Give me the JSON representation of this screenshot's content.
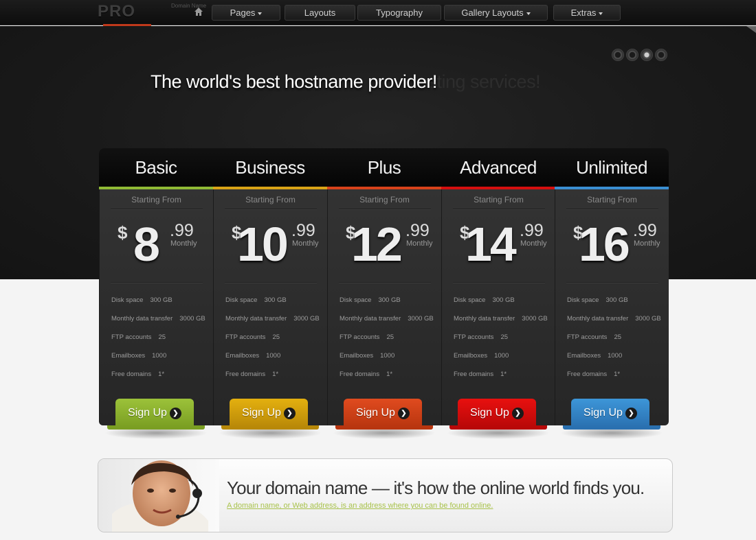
{
  "brand": {
    "logo": "PRO",
    "domain_tag": "Domain Name"
  },
  "nav": [
    {
      "label": "Pages",
      "dropdown": true
    },
    {
      "label": "Layouts",
      "dropdown": false
    },
    {
      "label": "Typography",
      "dropdown": false
    },
    {
      "label": "Gallery Layouts",
      "dropdown": true
    },
    {
      "label": "Extras",
      "dropdown": true
    }
  ],
  "hero": {
    "title": "The world's best hostname provider!",
    "ghost_text": "osting services!",
    "slides": 4,
    "active_slide": 3
  },
  "pricing": {
    "starting_label": "Starting From",
    "currency": "$",
    "period": "Monthly",
    "signup_label": "Sign Up",
    "plans": [
      {
        "name": "Basic",
        "price": "8",
        "cents": ".99",
        "accent": "#8fb935"
      },
      {
        "name": "Business",
        "price": "10",
        "cents": ".99",
        "accent": "#d9a316"
      },
      {
        "name": "Plus",
        "price": "12",
        "cents": ".99",
        "accent": "#d7421b"
      },
      {
        "name": "Advanced",
        "price": "14",
        "cents": ".99",
        "accent": "#d40f0f"
      },
      {
        "name": "Unlimited",
        "price": "16",
        "cents": ".99",
        "accent": "#3a8ed1"
      }
    ],
    "features": [
      {
        "label": "Disk space",
        "value": "300 GB"
      },
      {
        "label": "Monthly data transfer",
        "value": "3000 GB"
      },
      {
        "label": "FTP accounts",
        "value": "25"
      },
      {
        "label": "Emailboxes",
        "value": "1000"
      },
      {
        "label": "Free domains",
        "value": "1*"
      }
    ]
  },
  "banner": {
    "title": "Your domain name — it's how the online world finds you.",
    "link": "A domain name, or Web address, is an address where you can be found online."
  },
  "colors": {
    "basic_btn": "#9cc23a",
    "business_btn": "#e4b00f",
    "plus_btn": "#e04b1f",
    "advanced_btn": "#e8100f",
    "unlimited_btn": "#3d96d8"
  }
}
